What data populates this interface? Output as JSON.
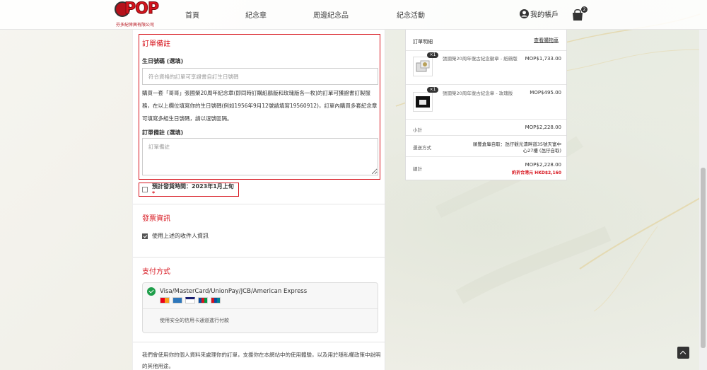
{
  "header": {
    "logo_text": "POP",
    "logo_subtitle": "芬多紀倖興有限公司",
    "nav": [
      "首頁",
      "紀念章",
      "周邊紀念品",
      "紀念活動"
    ],
    "account_label": "我的帳戶",
    "cart_count": "2"
  },
  "order_notes": {
    "title": "訂單備註",
    "birthday_label": "生日號碼 (選填)",
    "birthday_placeholder": "符合資格的訂單可享證書自訂生日號碼",
    "info": "購買一套「哥哥」張國榮20周年紀念章(即同時訂購紙鷂版和玫瑰版各一枚)的訂單可獲證書訂製服務，在以上欄位填寫你的生日號碼(例如1956年9月12號請填寫19560912)，訂單內購買多套紀念章可填寫多組生日號碼，請以逗號區隔。",
    "notes_label": "訂單備註 (選填)",
    "notes_placeholder": "訂單備註"
  },
  "shipping_ack": {
    "label": "預計發貨時間：2023年1月上旬",
    "required_mark": "*"
  },
  "invoice": {
    "title": "發票資訊",
    "use_shipping_label": "使用上述的收件人資訊"
  },
  "payment": {
    "title": "支付方式",
    "method_name": "Visa/MasterCard/UnionPay/JCB/American Express",
    "description": "使用安全的信用卡通道進行付款"
  },
  "privacy_text": "我們會使用你的個人資料來處理你的訂單，支援你在本網站中的使用體驗，以及用於隱私權政策中說明的其他用途。",
  "summary": {
    "title": "訂單明細",
    "view_cart": "查看購物車",
    "items": [
      {
        "qty": "×1",
        "name": "張國榮20周年復古紀念徽章 - 紙鷂版",
        "price": "MOP$1,733.00"
      },
      {
        "qty": "×1",
        "name": "張國榮20周年復古紀念章 - 玫瑰版",
        "price": "MOP$495.00"
      }
    ],
    "subtotal_label": "小計",
    "subtotal_value": "MOP$2,228.00",
    "shipping_label": "運送方式",
    "shipping_value": "順豐倉庫自取：氹仔觀光濤畔道35號天富中心27樓 (氹仔自取)",
    "total_label": "總計",
    "total_value": "MOP$2,228.00",
    "total_note": "約折合港元 HKD$2,160"
  },
  "colors": {
    "accent": "#d7141d",
    "success": "#1e9e4a"
  }
}
